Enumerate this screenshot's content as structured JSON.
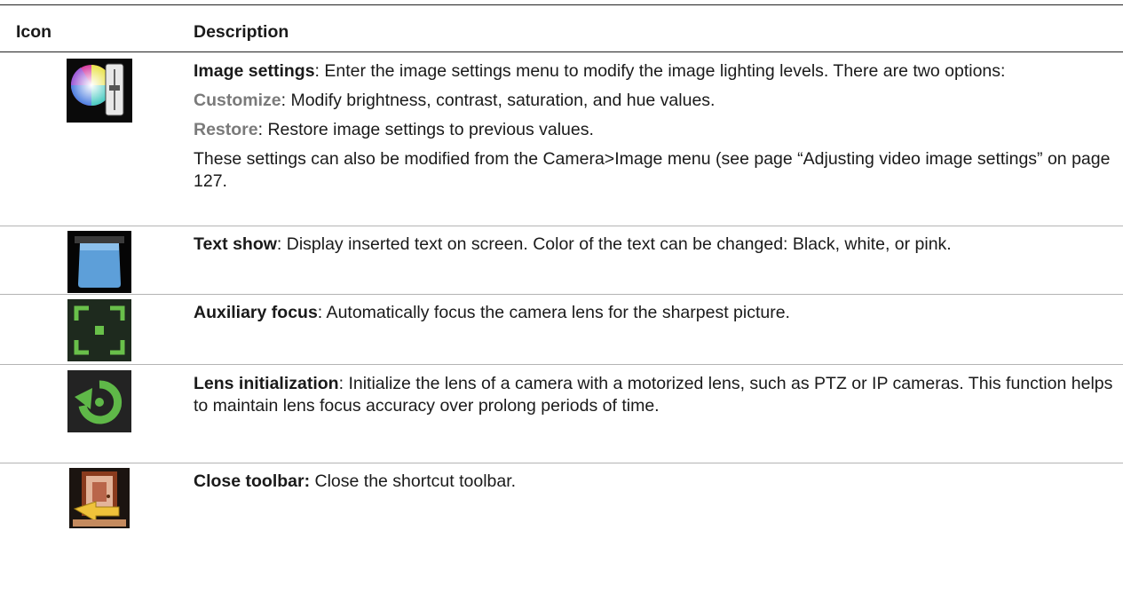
{
  "header": {
    "col_icon": "Icon",
    "col_description": "Description"
  },
  "rows": [
    {
      "icon": "image-settings-icon",
      "title": "Image settings",
      "text": ": Enter the image settings menu to modify the image lighting levels. There are two options:",
      "options": [
        {
          "name": "Customize",
          "text": ": Modify brightness, contrast, saturation, and hue values."
        },
        {
          "name": "Restore",
          "text": ": Restore image settings to previous values."
        }
      ],
      "note": "These settings can also be modified from the Camera>Image menu (see page “Adjusting video image settings” on page 127."
    },
    {
      "icon": "text-show-icon",
      "title": "Text show",
      "text": ": Display inserted text on screen. Color of the text can be changed: Black, white, or pink."
    },
    {
      "icon": "auxiliary-focus-icon",
      "title": "Auxiliary focus",
      "text": ": Automatically focus the camera lens for the sharpest picture."
    },
    {
      "icon": "lens-initialization-icon",
      "title": "Lens initialization",
      "text": ": Initialize the lens of a camera with a motorized lens, such as PTZ or IP cameras. This function helps to maintain lens focus accuracy over prolong periods of time."
    },
    {
      "icon": "close-toolbar-icon",
      "title": "Close toolbar:",
      "text": " Close the shortcut toolbar."
    }
  ]
}
